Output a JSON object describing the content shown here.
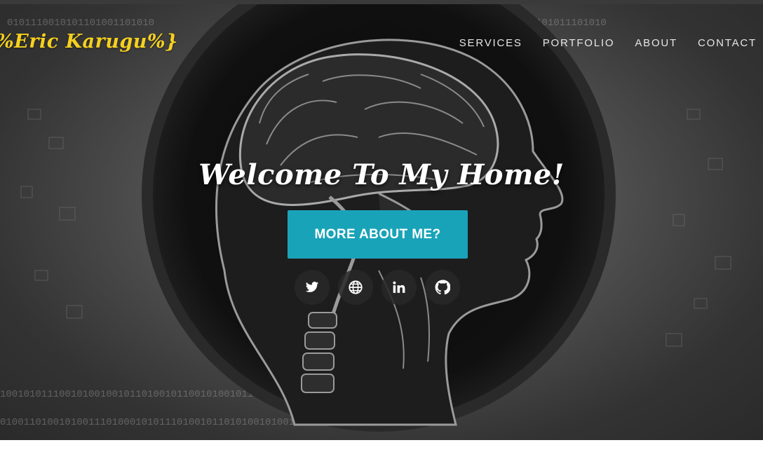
{
  "brand": {
    "text": "%Eric Karugu%}",
    "color": "#f5d020"
  },
  "nav": {
    "items": [
      {
        "label": "SERVICES"
      },
      {
        "label": "PORTFOLIO"
      },
      {
        "label": "ABOUT"
      },
      {
        "label": "CONTACT"
      }
    ]
  },
  "hero": {
    "headline": "Welcome To My Home!",
    "cta_label": "MORE ABOUT ME?",
    "cta_color": "#19a3b8",
    "socials": [
      {
        "icon": "twitter-icon"
      },
      {
        "icon": "globe-icon"
      },
      {
        "icon": "linkedin-icon"
      },
      {
        "icon": "github-icon"
      }
    ]
  }
}
